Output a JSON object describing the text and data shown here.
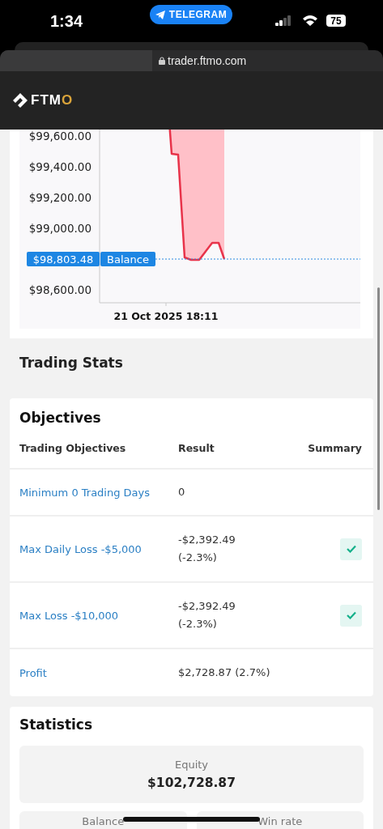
{
  "status_bar": {
    "time": "1:34",
    "back_app": "TELEGRAM",
    "battery": "75"
  },
  "browser": {
    "url": "trader.ftmo.com"
  },
  "header": {
    "logo": {
      "name": "FTM",
      "accent": "O"
    }
  },
  "chart": {
    "y_tick_labels": [
      "$99,600.00",
      "$99,400.00",
      "$99,200.00",
      "$99,000.00",
      "$98,600.00"
    ],
    "x_tick_label": "21 Oct 2025 18:11",
    "balance_marker": {
      "value": "$98,803.48",
      "label": "Balance"
    }
  },
  "section_title": "Trading Stats",
  "objectives": {
    "title": "Objectives",
    "columns": [
      "Trading Objectives",
      "Result",
      "Summary"
    ],
    "rows": [
      {
        "objective": "Minimum 0 Trading Days",
        "result": [
          "0"
        ],
        "passed": false
      },
      {
        "objective": "Max Daily Loss -$5,000",
        "result": [
          "-$2,392.49",
          "(-2.3%)"
        ],
        "passed": true
      },
      {
        "objective": "Max Loss -$10,000",
        "result": [
          "-$2,392.49",
          "(-2.3%)"
        ],
        "passed": true
      },
      {
        "objective": "Profit",
        "result": [
          "$2,728.87 (2.7%)"
        ],
        "passed": false
      }
    ]
  },
  "statistics": {
    "title": "Statistics",
    "equity": {
      "label": "Equity",
      "value": "$102,728.87"
    },
    "tiles": [
      {
        "label": "Balance"
      },
      {
        "label": "Win rate"
      }
    ]
  }
}
